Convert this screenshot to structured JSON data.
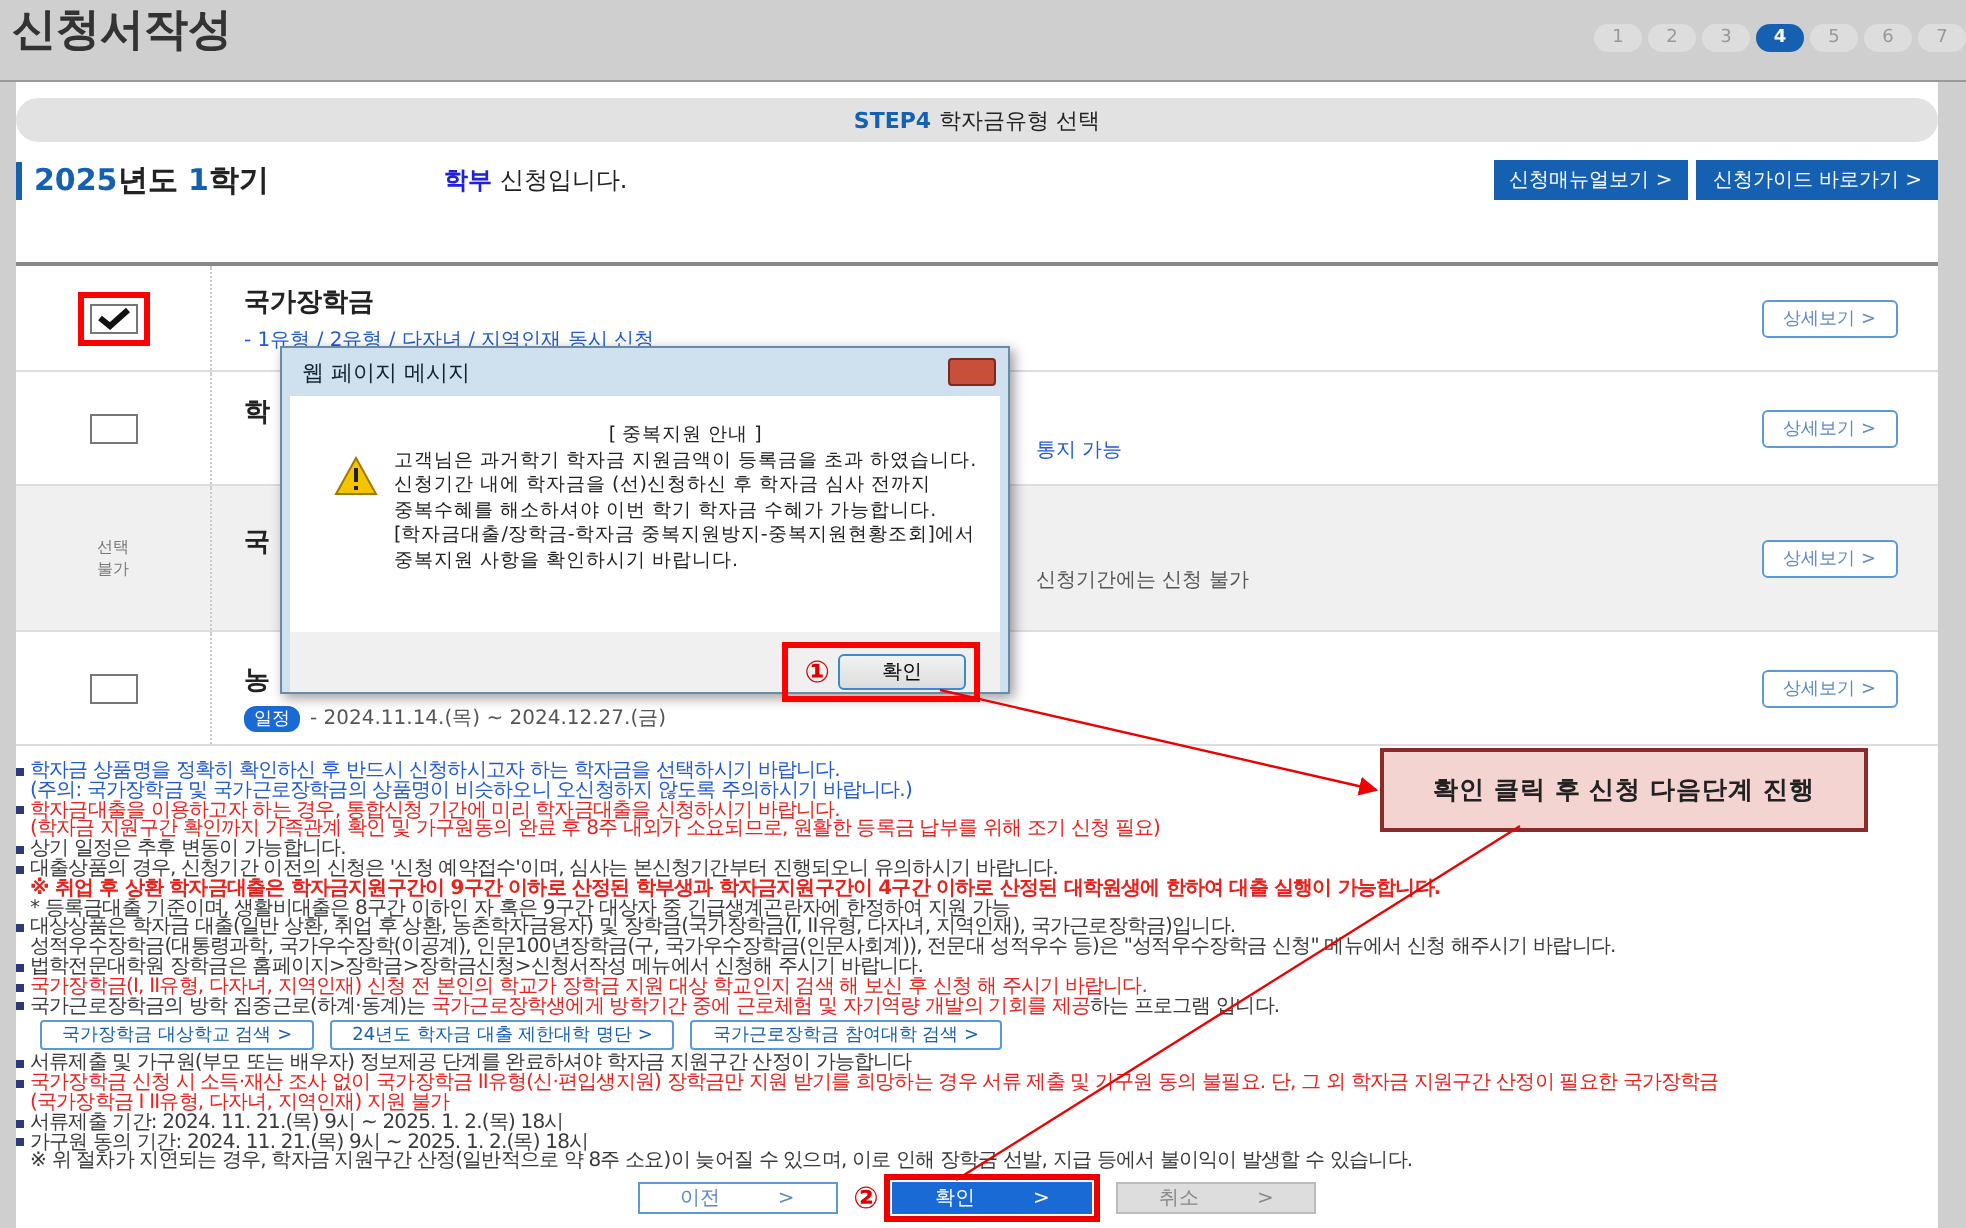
{
  "page_title": "신청서작성",
  "steps": [
    {
      "label": "1",
      "selected": false
    },
    {
      "label": "2",
      "selected": false
    },
    {
      "label": "3",
      "selected": false
    },
    {
      "label": "4",
      "selected": true
    },
    {
      "label": "5",
      "selected": false
    },
    {
      "label": "6",
      "selected": false
    },
    {
      "label": "7",
      "selected": false
    }
  ],
  "step_bar": {
    "step": "STEP4",
    "title": "학자금유형 선택"
  },
  "semester": {
    "year": "2025",
    "year_suffix": "년도",
    "term": "1",
    "term_suffix": "학기"
  },
  "program": {
    "type": "학부",
    "text": "신청입니다."
  },
  "top_buttons": [
    "신청매뉴얼보기 >",
    "신청가이드 바로가기 >"
  ],
  "rows": [
    {
      "kind": "checkbox",
      "checked": true,
      "highlighted": true,
      "title": "국가장학금",
      "lines": [
        {
          "text": "- 1유형 / 2유형 / 다자녀 / 지역인재 동시 신청",
          "color": "#1f5ad1"
        }
      ],
      "detail_button": "상세보기 >"
    },
    {
      "kind": "checkbox",
      "checked": false,
      "highlighted": false,
      "title": "학",
      "fragments": [
        {
          "text": "통지 가능",
          "color": "#1f5ad1"
        }
      ],
      "detail_button": "상세보기 >"
    },
    {
      "kind": "unavailable",
      "label": "선택\n불가",
      "title": "국",
      "fragments": [
        {
          "text": "신청기간에는 신청 불가",
          "color": "#555555"
        }
      ],
      "detail_button": "상세보기 >"
    },
    {
      "kind": "checkbox",
      "checked": false,
      "highlighted": false,
      "title": "농",
      "schedule": {
        "badge": "일정",
        "text": "- 2024.11.14.(목) ~ 2024.12.27.(금)"
      },
      "detail_button": "상세보기 >"
    }
  ],
  "dialog": {
    "title": "웹 페이지 메시지",
    "heading": "[ 중복지원 안내 ]",
    "message": [
      "고객님은 과거학기 학자금 지원금액이 등록금을 초과 하였습니다.",
      "신청기간 내에 학자금을 (선)신청하신 후 학자금 심사 전까지",
      "중복수혜를 해소하셔야 이번 학기 학자금 수혜가 가능합니다.",
      "[학자금대출/장학금-학자금 중복지원방지-중복지원현황조회]에서",
      "중복지원 사항을 확인하시기 바랍니다."
    ],
    "button": "확인",
    "marker": "①"
  },
  "callout": {
    "text": "확인 클릭 후 신청 다음단계 진행"
  },
  "notes": [
    {
      "kind": "text",
      "bullet": true,
      "bold": false,
      "parts": [
        {
          "text": "학자금 상품명을 정확히 확인하신 후 반드시 신청하시고자 하는 학자금을 선택하시기 바랍니다.",
          "color": "#1f5ad1"
        }
      ]
    },
    {
      "kind": "text",
      "bullet": false,
      "bold": false,
      "parts": [
        {
          "text": "(주의: 국가장학금 및 국가근로장학금의 상품명이 비슷하오니 오신청하지 않도록 주의하시기 바랍니다.)",
          "color": "#1f5ad1"
        }
      ]
    },
    {
      "kind": "text",
      "bullet": true,
      "bold": false,
      "parts": [
        {
          "text": "학자금대출을 이용하고자 하는 경우, 통합신청 기간에 미리 학자금대출을 신청하시기 바랍니다.",
          "color": "#e8231e"
        }
      ]
    },
    {
      "kind": "text",
      "bullet": false,
      "bold": false,
      "parts": [
        {
          "text": "(학자금 지원구간 확인까지 가족관계 확인 및 가구원동의 완료 후 8주 내외가 소요되므로, 원활한 등록금 납부를 위해 조기 신청 필요)",
          "color": "#e8231e"
        }
      ]
    },
    {
      "kind": "text",
      "bullet": true,
      "bold": false,
      "parts": [
        {
          "text": "상기 일정은 추후 변동이 가능합니다.",
          "color": "#3a3a3a"
        }
      ]
    },
    {
      "kind": "text",
      "bullet": true,
      "bold": false,
      "parts": [
        {
          "text": "대출상품의 경우, 신청기간 이전의 신청은 '신청 예약접수'이며, 심사는 본신청기간부터 진행되오니 유의하시기 바랍니다.",
          "color": "#3a3a3a"
        }
      ]
    },
    {
      "kind": "text",
      "bullet": false,
      "bold": true,
      "parts": [
        {
          "text": "※ 취업 후 상환 학자금대출은 학자금지원구간이 9구간 이하로 산정된 학부생과 학자금지원구간이 4구간 이하로 산정된 대학원생에 한하여 대출 실행이 가능합니다.",
          "color": "#e8231e"
        }
      ]
    },
    {
      "kind": "text",
      "bullet": false,
      "bold": false,
      "parts": [
        {
          "text": "* 등록금대출 기준이며, 생활비대출은 8구간 이하인 자 혹은 9구간 대상자 중 긴급생계곤란자에 한정하여 지원 가능",
          "color": "#3a3a3a"
        }
      ]
    },
    {
      "kind": "text",
      "bullet": true,
      "bold": false,
      "parts": [
        {
          "text": "대상상품은 학자금 대출(일반 상환, 취업 후 상환, 농촌학자금융자) 및 장학금(국가장학금(I, II유형, 다자녀, 지역인재), 국가근로장학금)입니다.",
          "color": "#3a3a3a"
        }
      ]
    },
    {
      "kind": "text",
      "bullet": false,
      "bold": false,
      "parts": [
        {
          "text": "성적우수장학금(대통령과학, 국가우수장학(이공계), 인문100년장학금(구, 국가우수장학금(인문사회계)), 전문대 성적우수 등)은 \"성적우수장학금 신청\" 메뉴에서 신청 해주시기 바랍니다.",
          "color": "#3a3a3a"
        }
      ]
    },
    {
      "kind": "text",
      "bullet": true,
      "bold": false,
      "parts": [
        {
          "text": "법학전문대학원 장학금은 홈페이지>장학금>장학금신청>신청서작성 메뉴에서 신청해 주시기 바랍니다.",
          "color": "#3a3a3a"
        }
      ]
    },
    {
      "kind": "text",
      "bullet": true,
      "bold": false,
      "parts": [
        {
          "text": "국가장학금(I, II유형, 다자녀, 지역인재) 신청 전 본인의 학교가 장학금 지원 대상 학교인지 검색 해 보신 후 신청 해 주시기 바랍니다.",
          "color": "#e8231e"
        }
      ]
    },
    {
      "kind": "text",
      "bullet": true,
      "bold": false,
      "parts": [
        {
          "text": "국가근로장학금의 방학 집중근로(하계·동계)는 ",
          "color": "#3a3a3a"
        },
        {
          "text": "국가근로장학생에게 방학기간 중에 근로체험 및 자기역량 개발의 기회를 제공",
          "color": "#e8231e"
        },
        {
          "text": "하는 프로그램 입니다.",
          "color": "#3a3a3a"
        }
      ]
    },
    {
      "kind": "links",
      "items": [
        "국가장학금 대상학교 검색 >",
        "24년도 학자금 대출 제한대학 명단 >",
        "국가근로장학금 참여대학 검색 >"
      ]
    },
    {
      "kind": "text",
      "bullet": true,
      "bold": false,
      "parts": [
        {
          "text": "서류제출 및 가구원(부모 또는 배우자) 정보제공 단계를 완료하셔야 학자금 지원구간 산정이 가능합니다",
          "color": "#3a3a3a"
        }
      ]
    },
    {
      "kind": "text",
      "bullet": true,
      "bold": false,
      "parts": [
        {
          "text": "국가장학금 신청 시 소득·재산 조사 없이 국가장학금 II유형(신·편입생지원) 장학금만 지원 받기를 희망하는 경우 서류 제출 및 가구원 동의 불필요. 단, 그 외 학자금 지원구간 산정이 필요한 국가장학금",
          "color": "#e8231e"
        }
      ]
    },
    {
      "kind": "text",
      "bullet": false,
      "bold": false,
      "parts": [
        {
          "text": "(국가장학금 I II유형, 다자녀, 지역인재) 지원 불가",
          "color": "#e8231e"
        }
      ]
    },
    {
      "kind": "text",
      "bullet": true,
      "bold": false,
      "parts": [
        {
          "text": "서류제출 기간: 2024. 11. 21.(목) 9시 ~ 2025. 1. 2.(목) 18시",
          "color": "#3a3a3a"
        }
      ]
    },
    {
      "kind": "text",
      "bullet": true,
      "bold": false,
      "parts": [
        {
          "text": "가구원 동의 기간: 2024. 11. 21.(목) 9시 ~ 2025. 1. 2.(목) 18시",
          "color": "#3a3a3a"
        }
      ]
    },
    {
      "kind": "text",
      "bullet": false,
      "bold": false,
      "parts": [
        {
          "text": "※ 위 절차가 지연되는 경우, 학자금 지원구간 산정(일반적으로 약 8주 소요)이 늦어질 수 있으며, 이로 인해 장학금 선발, 지급 등에서 불이익이 발생할 수 있습니다.",
          "color": "#3a3a3a"
        }
      ]
    }
  ],
  "bottom_buttons": [
    {
      "label": "이전",
      "arrow": ">",
      "kind": "outline",
      "highlighted": false
    },
    {
      "label": "확인",
      "arrow": ">",
      "kind": "primary",
      "highlighted": true,
      "marker": "②"
    },
    {
      "label": "취소",
      "arrow": ">",
      "kind": "grey",
      "highlighted": false
    }
  ]
}
